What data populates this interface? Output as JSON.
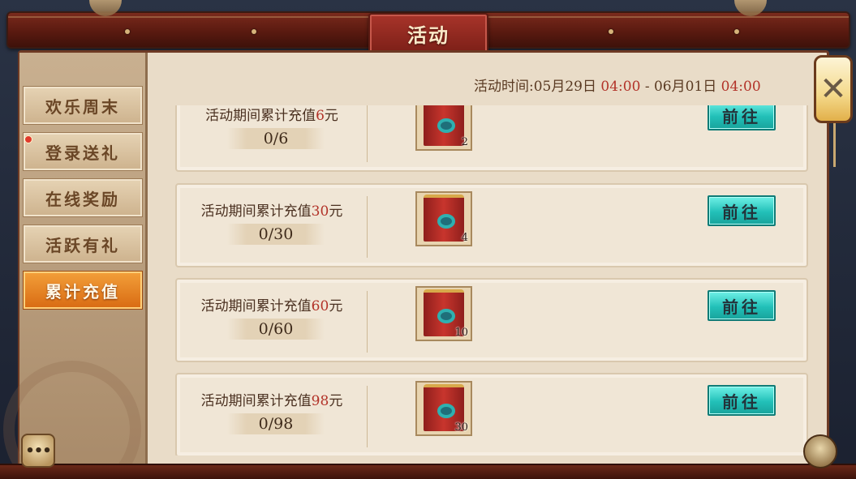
{
  "header": {
    "title": "活动"
  },
  "sidebar": {
    "tabs": [
      {
        "label": "欢乐周末",
        "active": false
      },
      {
        "label": "登录送礼",
        "active": false,
        "badge": true
      },
      {
        "label": "在线奖励",
        "active": false
      },
      {
        "label": "活跃有礼",
        "active": false
      },
      {
        "label": "累计充值",
        "active": true
      }
    ]
  },
  "activity_time": {
    "prefix": "活动时间:",
    "start_date": "05月29日",
    "start_time": "04:00",
    "separator": "-",
    "end_date": "06月01日",
    "end_time": "04:00"
  },
  "rewards": [
    {
      "req_prefix": "活动期间累计充值",
      "amount": "6",
      "unit": "元",
      "progress": "0/6",
      "item_count": "2",
      "button": "前往"
    },
    {
      "req_prefix": "活动期间累计充值",
      "amount": "30",
      "unit": "元",
      "progress": "0/30",
      "item_count": "4",
      "button": "前往"
    },
    {
      "req_prefix": "活动期间累计充值",
      "amount": "60",
      "unit": "元",
      "progress": "0/60",
      "item_count": "10",
      "button": "前往"
    },
    {
      "req_prefix": "活动期间累计充值",
      "amount": "98",
      "unit": "元",
      "progress": "0/98",
      "item_count": "30",
      "button": "前往"
    }
  ],
  "icons": {
    "close": "close-icon",
    "chat": "chat-icon",
    "skill": "skill-icon",
    "reward_item": "red-scroll-icon"
  },
  "colors": {
    "accent_red": "#b23228",
    "active_tab": "#e8861e",
    "go_button": "#22c0b8"
  }
}
